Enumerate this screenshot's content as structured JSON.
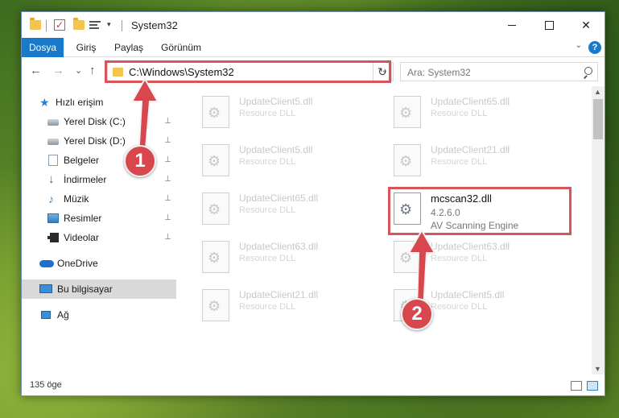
{
  "window": {
    "title": "System32",
    "controls": {
      "minimize": "—",
      "maximize": "☐",
      "close": "✕"
    }
  },
  "quick_access_toolbar": {
    "dropdown": "▾"
  },
  "ribbon": {
    "tabs": [
      {
        "label": "Dosya",
        "active": true
      },
      {
        "label": "Giriş"
      },
      {
        "label": "Paylaş"
      },
      {
        "label": "Görünüm"
      }
    ],
    "expand_icon": "⌄",
    "help_label": "?"
  },
  "navigation": {
    "back": "←",
    "forward": "→",
    "recent": "⌄",
    "up": "↑",
    "address": "C:\\Windows\\System32",
    "address_dropdown": "⌄",
    "refresh": "↻",
    "search_placeholder": "Ara: System32"
  },
  "sidebar": {
    "items": [
      {
        "label": "Hızlı erişim",
        "icon": "star-icon",
        "pinned": false
      },
      {
        "label": "Yerel Disk (C:)",
        "icon": "disk-icon",
        "pinned": true
      },
      {
        "label": "Yerel Disk (D:)",
        "icon": "disk-icon",
        "pinned": true
      },
      {
        "label": "Belgeler",
        "icon": "document-icon",
        "pinned": true
      },
      {
        "label": "İndirmeler",
        "icon": "download-icon",
        "pinned": true
      },
      {
        "label": "Müzik",
        "icon": "music-icon",
        "pinned": true
      },
      {
        "label": "Resimler",
        "icon": "pictures-icon",
        "pinned": true
      },
      {
        "label": "Videolar",
        "icon": "video-icon",
        "pinned": true
      },
      {
        "label": "OneDrive",
        "icon": "cloud-icon",
        "pinned": false
      },
      {
        "label": "Bu bilgisayar",
        "icon": "computer-icon",
        "pinned": false,
        "selected": true
      },
      {
        "label": "Ağ",
        "icon": "network-icon",
        "pinned": false
      }
    ],
    "pin_glyph": "📌"
  },
  "files": [
    {
      "name": "UpdateClient5.dll",
      "desc": "Resource DLL"
    },
    {
      "name": "UpdateClient65.dll",
      "desc": "Resource DLL"
    },
    {
      "name": "UpdateClient5.dll",
      "desc": "Resource DLL"
    },
    {
      "name": "UpdateClient21.dll",
      "desc": "Resource DLL"
    },
    {
      "name": "UpdateClient65.dll",
      "desc": "Resource DLL"
    },
    {
      "name": "mcscan32.dll",
      "version": "4.2.6.0",
      "desc": "AV Scanning Engine",
      "highlighted": true
    },
    {
      "name": "UpdateClient63.dll",
      "desc": "Resource DLL"
    },
    {
      "name": "UpdateClient63.dll",
      "desc": "Resource DLL"
    },
    {
      "name": "UpdateClient21.dll",
      "desc": "Resource DLL"
    },
    {
      "name": "UpdateClient5.dll",
      "desc": "Resource DLL"
    }
  ],
  "status": {
    "item_count": "135 öge"
  },
  "scrollbar": {
    "up": "▲",
    "down": "▼"
  },
  "annotations": {
    "step1": "1",
    "step2": "2",
    "color": "#d9474e"
  }
}
